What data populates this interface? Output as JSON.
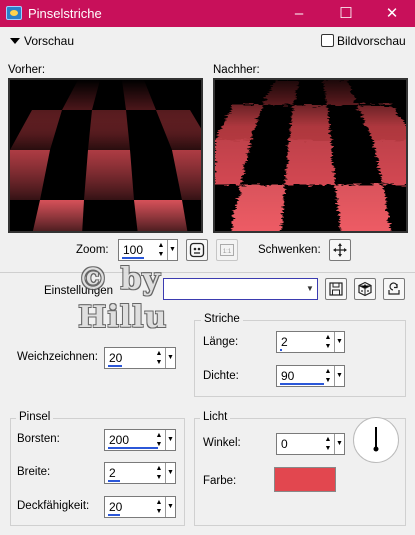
{
  "window": {
    "title": "Pinselstriche",
    "minimize_glyph": "–",
    "maximize_glyph": "☐",
    "close_glyph": "✕"
  },
  "preview": {
    "toggle_label": "Vorschau",
    "bildvorschau_label": "Bildvorschau",
    "bildvorschau_checked": false
  },
  "panels": {
    "before_label": "Vorher:",
    "after_label": "Nachher:"
  },
  "zoom": {
    "label": "Zoom:",
    "value": "100"
  },
  "pan": {
    "label": "Schwenken:"
  },
  "presets": {
    "label": "Einstellungen",
    "value": ""
  },
  "weichzeichnen": {
    "label": "Weichzeichnen:",
    "value": "20"
  },
  "striche": {
    "title": "Striche",
    "laenge_label": "Länge:",
    "laenge_value": "2",
    "dichte_label": "Dichte:",
    "dichte_value": "90"
  },
  "pinsel": {
    "title": "Pinsel",
    "borsten_label": "Borsten:",
    "borsten_value": "200",
    "breite_label": "Breite:",
    "breite_value": "2",
    "deckfaehigkeit_label": "Deckfähigkeit:",
    "deckfaehigkeit_value": "20"
  },
  "licht": {
    "title": "Licht",
    "winkel_label": "Winkel:",
    "winkel_value": "0",
    "farbe_label": "Farbe:",
    "farbe_color": "#e2474f"
  },
  "watermark": {
    "line1": "© by",
    "line2": "Hillu"
  },
  "colors": {
    "titlebar": "#c8105a",
    "checker_light": "#e8505a",
    "checker_dark": "#000000",
    "accent": "#2b57d8"
  }
}
